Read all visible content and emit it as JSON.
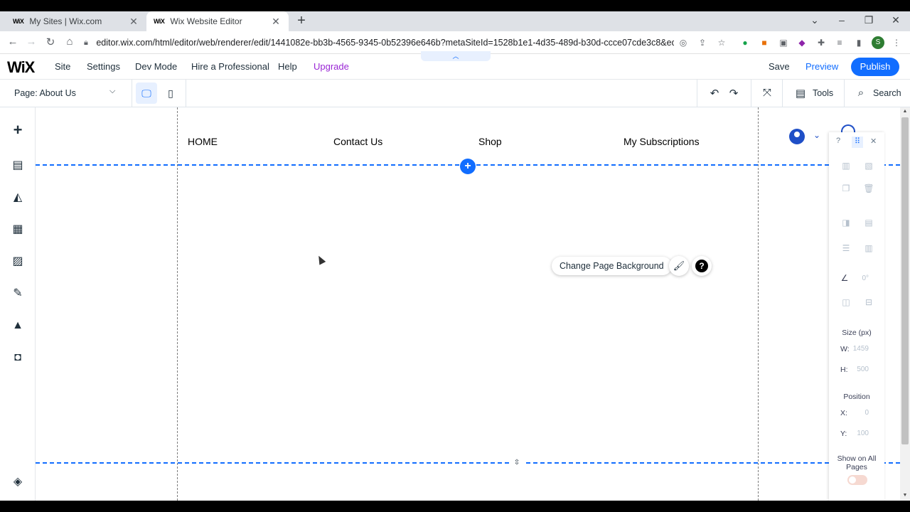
{
  "browser": {
    "tabs": [
      {
        "favicon": "WiX",
        "title": "My Sites | Wix.com",
        "close": "✕"
      },
      {
        "favicon": "WiX",
        "title": "Wix Website Editor",
        "close": "✕"
      }
    ],
    "new_tab": "+",
    "url": "editor.wix.com/html/editor/web/renderer/edit/1441082e-bb3b-4565-9345-0b52396e646b?metaSiteId=1528b1e1-4d35-489d-b30d-ccce07cde3c8&editor...",
    "profile_initial": "S"
  },
  "wix_top": {
    "logo": "WiX",
    "menu": [
      "Site",
      "Settings",
      "Dev Mode",
      "Hire a Professional",
      "Help",
      "Upgrade"
    ],
    "save": "Save",
    "preview": "Preview",
    "publish": "Publish"
  },
  "wix_toolbar": {
    "page_label": "Page: About Us",
    "tools": "Tools",
    "search": "Search"
  },
  "canvas": {
    "nav_links": [
      "HOME",
      "Contact Us",
      "Shop",
      "My Subscriptions"
    ],
    "change_background": "Change Page Background"
  },
  "properties": {
    "help": "?",
    "rotation_value": "0°",
    "size_label": "Size (px)",
    "w_key": "W:",
    "w_value": "1459",
    "h_key": "H:",
    "h_value": "500",
    "position_label": "Position",
    "x_key": "X:",
    "x_value": "0",
    "y_key": "Y:",
    "y_value": "100",
    "show_on_all_pages": "Show on All Pages",
    "show_on_all_pages_enabled": false
  },
  "colors": {
    "accent": "#116dff",
    "upgrade": "#9a27d5",
    "icon_blue": "#1f4fc7"
  }
}
